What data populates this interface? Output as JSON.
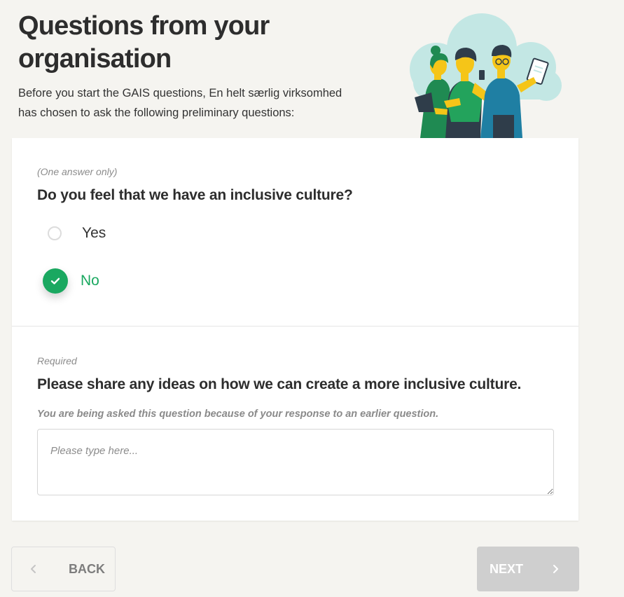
{
  "header": {
    "title": "Questions from your organisation",
    "intro_line1": "Before you start the GAIS questions, En helt særlig virksomhed",
    "intro_line2": "has chosen to ask the following preliminary questions:"
  },
  "question1": {
    "hint": "(One answer only)",
    "text": "Do you feel that we have an inclusive culture?",
    "options": [
      {
        "label": "Yes",
        "selected": false
      },
      {
        "label": "No",
        "selected": true
      }
    ]
  },
  "question2": {
    "hint": "Required",
    "text": "Please share any ideas on how we can create a more inclusive culture.",
    "note": "You are being asked this question because of your response to an earlier question.",
    "value": "",
    "placeholder": "Please type here..."
  },
  "nav": {
    "back_label": "BACK",
    "next_label": "NEXT"
  },
  "colors": {
    "accent": "#1aa860",
    "background": "#f5f4f0",
    "card": "#ffffff",
    "next_disabled": "#cfcfcf",
    "illustration_cloud": "#c3e7e4",
    "illustration_yellow": "#f5c518"
  },
  "icons": {
    "check": "check-icon",
    "back": "chevron-left-icon",
    "next": "chevron-right-icon"
  }
}
